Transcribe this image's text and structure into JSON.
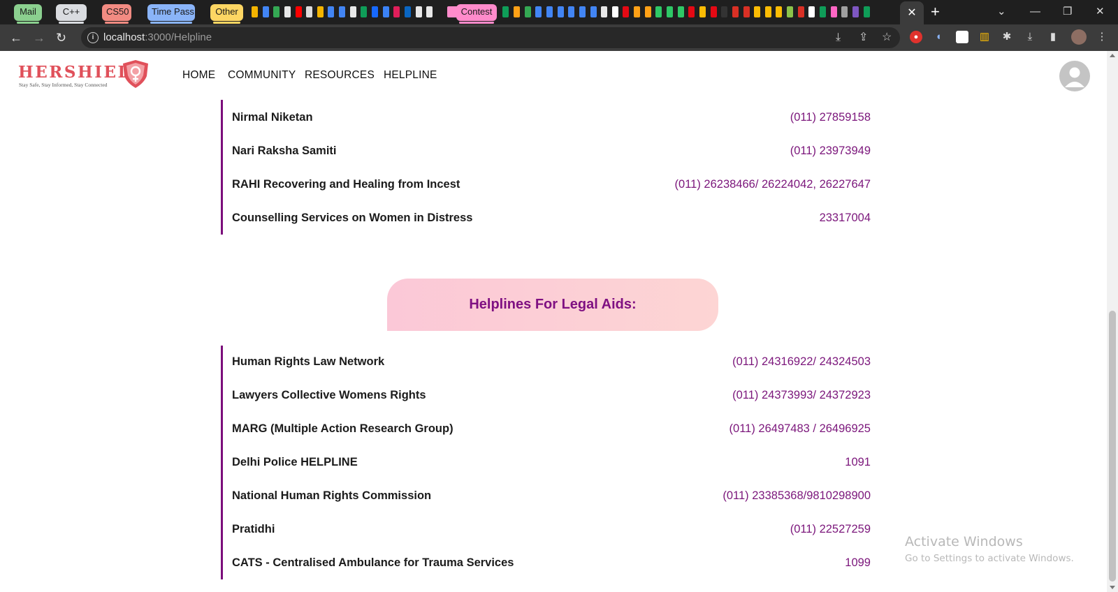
{
  "browser": {
    "bookmark_groups": [
      {
        "label": "Mail",
        "color": "#8bd08f"
      },
      {
        "label": "C++",
        "color": "#dadce0"
      },
      {
        "label": "CS50",
        "color": "#f28b82"
      },
      {
        "label": "Time Pass",
        "color": "#8ab4f8"
      },
      {
        "label": "Other",
        "color": "#fdd663"
      },
      {
        "label": "Contest",
        "color": "#ff8bcb"
      }
    ],
    "active_tab_close": "✕",
    "new_tab": "+",
    "window_controls": {
      "tabs_menu": "⌄",
      "minimize": "—",
      "restore": "❐",
      "close": "✕"
    },
    "url": {
      "host": "localhost",
      "path": ":3000/Helpline"
    }
  },
  "site": {
    "logo_text": "HERSHIELD",
    "logo_tagline": "Stay Safe, Stay Informed, Stay Connected",
    "brand_color": "#e0505a",
    "accent_color": "#7b0e7b",
    "nav": [
      "HOME",
      "COMMUNITY",
      "RESOURCES",
      "HELPLINE"
    ],
    "avatar_icon": "user-avatar-icon"
  },
  "content": {
    "section_top": [
      {
        "name": "Nirmal Niketan",
        "phone": "(011) 27859158"
      },
      {
        "name": "Nari Raksha Samiti",
        "phone": "(011) 23973949"
      },
      {
        "name": "RAHI Recovering and Healing from Incest",
        "phone": "(011) 26238466/ 26224042, 26227647"
      },
      {
        "name": "Counselling Services on Women in Distress",
        "phone": "23317004"
      }
    ],
    "legal_heading": "Helplines For Legal Aids:",
    "legal": [
      {
        "name": "Human Rights Law Network",
        "phone": "(011) 24316922/ 24324503"
      },
      {
        "name": "Lawyers Collective Womens Rights",
        "phone": "(011) 24373993/ 24372923"
      },
      {
        "name": "MARG (Multiple Action Research Group)",
        "phone": "(011) 26497483 / 26496925"
      },
      {
        "name": "Delhi Police HELPLINE",
        "phone": "1091"
      },
      {
        "name": "National Human Rights Commission",
        "phone": "(011) 23385368/9810298900"
      },
      {
        "name": "Pratidhi",
        "phone": "(011) 22527259"
      },
      {
        "name": "CATS - Centralised Ambulance for Trauma Services",
        "phone": "1099"
      }
    ]
  },
  "watermark": {
    "title": "Activate Windows",
    "subtitle": "Go to Settings to activate Windows."
  }
}
